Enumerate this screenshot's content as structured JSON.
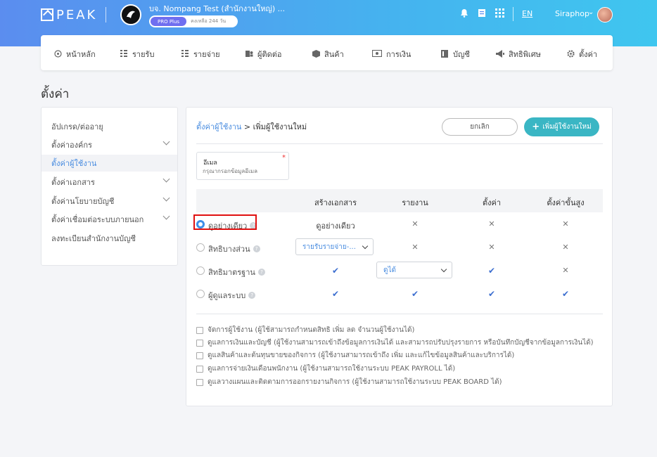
{
  "header": {
    "logo_text": "PEAK",
    "company_name": "บจ. Nompang Test (สำนักงานใหญ่) ...",
    "plan": "PRO Plus",
    "plan_remaining": "คงเหลือ 244 วัน",
    "language": "EN",
    "user_name": "Siraphop"
  },
  "nav": {
    "items": [
      {
        "label": "หน้าหลัก",
        "icon": "home-icon"
      },
      {
        "label": "รายรับ",
        "icon": "income-icon"
      },
      {
        "label": "รายจ่าย",
        "icon": "expense-icon"
      },
      {
        "label": "ผู้ติดต่อ",
        "icon": "contact-icon"
      },
      {
        "label": "สินค้า",
        "icon": "product-box-icon"
      },
      {
        "label": "การเงิน",
        "icon": "money-icon"
      },
      {
        "label": "บัญชี",
        "icon": "accounting-book-icon"
      },
      {
        "label": "สิทธิพิเศษ",
        "icon": "megaphone-icon"
      },
      {
        "label": "ตั้งค่า",
        "icon": "gear-icon"
      }
    ]
  },
  "page": {
    "title": "ตั้งค่า"
  },
  "sidebar": {
    "items": [
      {
        "label": "อัปเกรด/ต่ออายุ"
      },
      {
        "label": "ตั้งค่าองค์กร"
      },
      {
        "label": "ตั้งค่าผู้ใช้งาน"
      },
      {
        "label": "ตั้งค่าเอกสาร"
      },
      {
        "label": "ตั้งค่านโยบายบัญชี"
      },
      {
        "label": "ตั้งค่าเชื่อมต่อระบบภายนอก"
      },
      {
        "label": "ลงทะเบียนสำนักงานบัญชี"
      }
    ]
  },
  "main": {
    "breadcrumb_link": "ตั้งค่าผู้ใช้งาน",
    "breadcrumb_current": " > เพิ่มผู้ใช้งานใหม่",
    "cancel_label": "ยกเลิก",
    "add_label": "เพิ่มผู้ใช้งานใหม่",
    "email": {
      "label": "อีเมล",
      "placeholder": "กรุณากรอกข้อมูลอีเมล"
    },
    "table": {
      "headers": [
        "สร้างเอกสาร",
        "รายงาน",
        "ตั้งค่า",
        "ตั้งค่าขั้นสูง"
      ],
      "rows": [
        {
          "label": "ดูอย่างเดียว",
          "col1": "ดูอย่างเดียว"
        },
        {
          "label": "สิทธิบางส่วน",
          "col1": "รายรับรายจ่าย-..."
        },
        {
          "label": "สิทธิมาตรฐาน",
          "col2": "ดูได้"
        },
        {
          "label": "ผู้ดูแลระบบ"
        }
      ]
    },
    "options": [
      "จัดการผู้ใช้งาน (ผู้ใช้สามารถกำหนดสิทธิ เพิ่ม ลด จำนวนผู้ใช้งานได้)",
      "ดูแลการเงินและบัญชี (ผู้ใช้งานสามารถเข้าถึงข้อมูลการเงินได้ และสามารถปรับปรุงรายการ หรือบันทึกบัญชีจากข้อมูลการเงินได้)",
      "ดูแลสินค้าและต้นทุนขายของกิจการ (ผู้ใช้งานสามารถเข้าถึง เพิ่ม และแก้ไขข้อมูลสินค้าและบริการได้)",
      "ดูแลการจ่ายเงินเดือนพนักงาน (ผู้ใช้งานสามารถใช้งานระบบ PEAK PAYROLL ได้)",
      "ดูแลวางแผนและติดตามการออกรายงานกิจการ (ผู้ใช้งานสามารถใช้งานระบบ PEAK BOARD ได้)"
    ]
  }
}
